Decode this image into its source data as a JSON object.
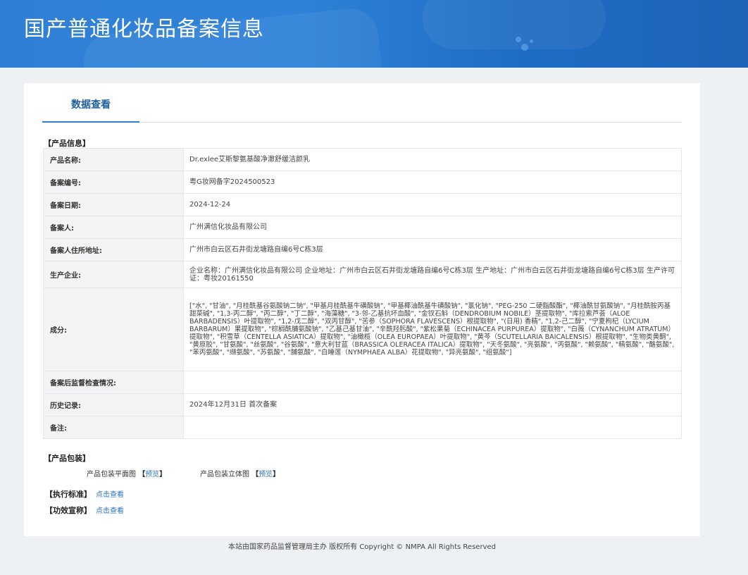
{
  "header": {
    "title": "国产普通化妆品备案信息"
  },
  "tabs": [
    {
      "label": "数据查看",
      "active": true
    }
  ],
  "product_info": {
    "section_title": "【产品信息】",
    "rows": [
      {
        "label": "产品名称:",
        "value": "Dr.exlee艾斯黎氨基酸净澈舒缓洁颜乳"
      },
      {
        "label": "备案编号:",
        "value": "粤G妆网备字2024500523"
      },
      {
        "label": "备案日期:",
        "value": "2024-12-24"
      },
      {
        "label": "备案人:",
        "value": "广州满信化妆品有限公司"
      },
      {
        "label": "备案人住所地址:",
        "value": "广州市白云区石井街龙塘路自编6号C栋3层"
      },
      {
        "label": "生产企业:",
        "value": "企业名称：广州满信化妆品有限公司 企业地址：广州市白云区石井街龙塘路自编6号C栋3层 生产地址：广州市白云区石井街龙塘路自编6号C栋3层 生产许可证：粤妆20161550"
      },
      {
        "label": "成分:",
        "value": "[\"水\", \"甘油\", \"月桂酰基谷氨酸钠二钠\", \"甲基月桂酰基牛磺酸钠\", \"甲基椰油酰基牛磺酸钠\", \"氯化钠\", \"PEG-250 二硬脂酸酯\", \"椰油酰甘氨酸钠\", \"月桂酰胺丙基甜菜碱\", \"1,3-丙二醇\", \"丙二醇\", \"丁二醇\", \"海藻糖\", \"3-邻-乙基抗坏血酸\", \"金钗石斛（DENDROBIUM NOBILE）茎提取物\", \"库拉索芦荟（ALOE BARBADENSIS）叶提取物\", \"1,2-戊二醇\", \"双丙甘醇\", \"苦参（SOPHORA FLAVESCENS）根提取物\", \"(日用) 香精\", \"1,2-己二醇\", \"宁夏枸杞（LYCIUM BARBARUM）果提取物\", \"棕榈酰脯氨酸钠\", \"乙基己基甘油\", \"辛酰羟肟酸\", \"紫松果菊（ECHINACEA PURPUREA）提取物\", \"白薇（CYNANCHUM ATRATUM）提取物\", \"积雪草（CENTELLA ASIATICA）提取物\", \"油橄榄（OLEA EUROPAEA）叶提取物\", \"黄芩（SCUTELLARIA BAICALENSIS）根提取物\", \"生物类黄酮\", \"黄原胶\", \"甘氨酸\", \"丝氨酸\", \"谷氨酸\", \"意大利甘蓝（BRASSICA OLERACEA ITALICA）提取物\", \"天冬氨酸\", \"亮氨酸\", \"丙氨酸\", \"赖氨酸\", \"精氨酸\", \"酪氨酸\", \"苯丙氨酸\", \"缬氨酸\", \"苏氨酸\", \"脯氨酸\", \"白睡莲（NYMPHAEA ALBA）花提取物\", \"异亮氨酸\", \"组氨酸\"]"
      },
      {
        "label": "备案后监督检查情况:",
        "value": ""
      },
      {
        "label": "历史记录:",
        "value": "2024年12月31日 首次备案"
      },
      {
        "label": "备注:",
        "value": ""
      }
    ]
  },
  "packaging": {
    "section_title": "【产品包装】",
    "items": [
      {
        "label": "产品包装平面图",
        "bracket_open": "【",
        "link": "预览",
        "bracket_close": "】"
      },
      {
        "label": "产品包装立体图",
        "bracket_open": "【",
        "link": "预览",
        "bracket_close": "】"
      }
    ]
  },
  "standard": {
    "label": "【执行标准】",
    "link": "点击查看"
  },
  "efficacy": {
    "label": "【功效宣称】",
    "link": "点击查看"
  },
  "footer": {
    "text": "本站由国家药品监督管理局主办 版权所有 Copyright © NMPA All Rights Reserved"
  },
  "colors": {
    "banner": "#2f7fd6",
    "link": "#2a72c0",
    "tab_active": "#1f5f9e"
  }
}
